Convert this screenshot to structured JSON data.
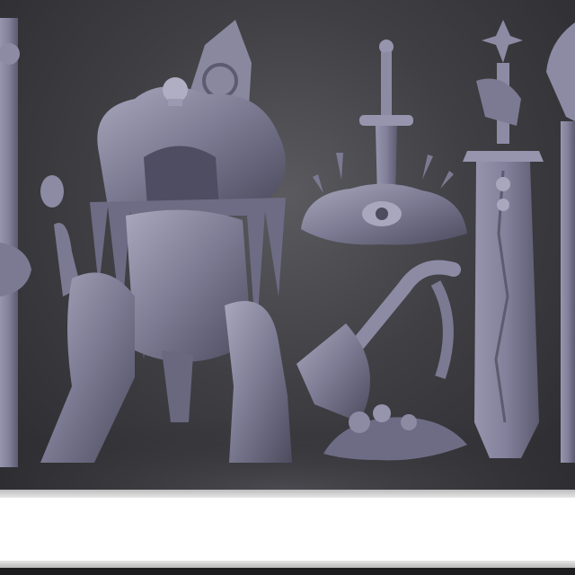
{
  "scene": {
    "background_color": "#3f3f44",
    "model_color": "#7c7a92",
    "model_shadow_color": "#4d4b5e",
    "model_highlight_color": "#a9a7bd",
    "accent_color": "#6e4a4a"
  },
  "band_color": "#ffffff"
}
